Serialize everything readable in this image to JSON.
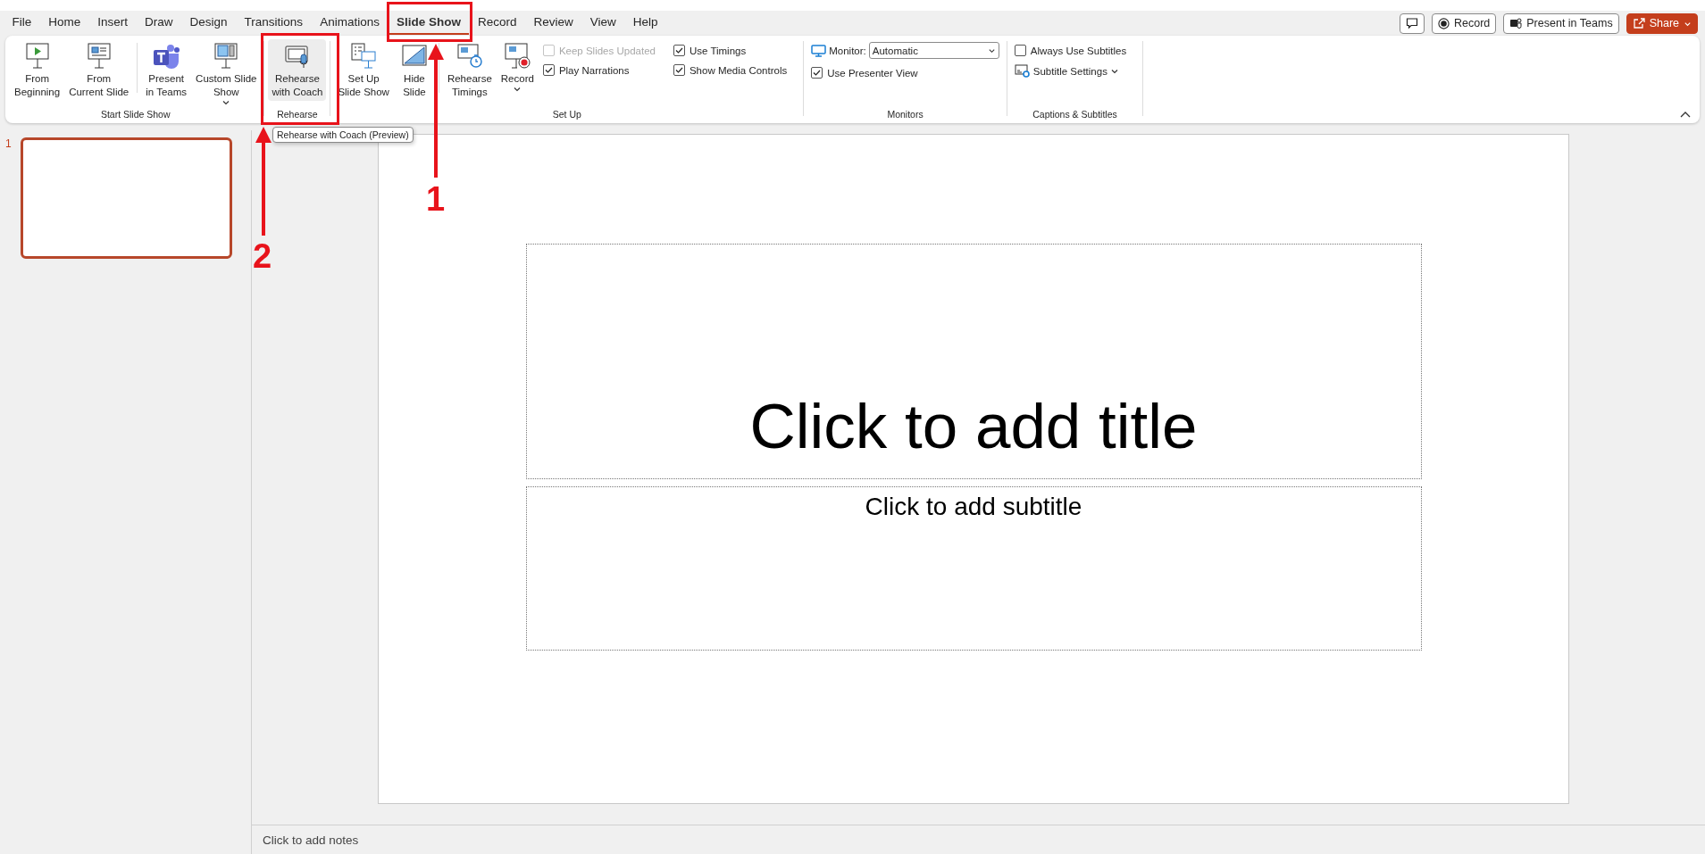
{
  "tabs": [
    {
      "label": "File",
      "selected": false
    },
    {
      "label": "Home",
      "selected": false
    },
    {
      "label": "Insert",
      "selected": false
    },
    {
      "label": "Draw",
      "selected": false
    },
    {
      "label": "Design",
      "selected": false
    },
    {
      "label": "Transitions",
      "selected": false
    },
    {
      "label": "Animations",
      "selected": false
    },
    {
      "label": "Slide Show",
      "selected": true
    },
    {
      "label": "Record",
      "selected": false
    },
    {
      "label": "Review",
      "selected": false
    },
    {
      "label": "View",
      "selected": false
    },
    {
      "label": "Help",
      "selected": false
    }
  ],
  "title_bar_buttons": [
    {
      "kind": "comments"
    },
    {
      "kind": "record",
      "label": "Record"
    },
    {
      "kind": "teams",
      "label": "Present in Teams"
    },
    {
      "kind": "share",
      "label": "Share"
    }
  ],
  "ribbon": {
    "groups": [
      {
        "label": "Start Slide Show",
        "items": [
          {
            "kind": "large",
            "lines": [
              "From",
              "Beginning"
            ],
            "has_menu": false,
            "highlighted": false
          },
          {
            "kind": "large",
            "lines": [
              "From",
              "Current Slide"
            ],
            "has_menu": false,
            "highlighted": false
          },
          {
            "kind": "separator"
          },
          {
            "kind": "large",
            "lines": [
              "Present",
              "in Teams"
            ],
            "has_menu": false,
            "highlighted": false
          },
          {
            "kind": "large",
            "lines": [
              "Custom Slide",
              "Show"
            ],
            "has_menu": true,
            "highlighted": false
          }
        ]
      },
      {
        "label": "Rehearse",
        "items": [
          {
            "kind": "large",
            "lines": [
              "Rehearse",
              "with Coach"
            ],
            "has_menu": false,
            "highlighted": true
          }
        ]
      },
      {
        "label": "Set Up",
        "items": [
          {
            "kind": "large",
            "lines": [
              "Set Up",
              "Slide Show"
            ],
            "has_menu": false,
            "highlighted": false
          },
          {
            "kind": "large",
            "lines": [
              "Hide",
              "Slide"
            ],
            "has_menu": false,
            "highlighted": false
          },
          {
            "kind": "separator"
          },
          {
            "kind": "large",
            "lines": [
              "Rehearse",
              "Timings"
            ],
            "has_menu": false,
            "highlighted": false
          },
          {
            "kind": "large",
            "lines": [
              "Record"
            ],
            "has_menu": true,
            "highlighted": false
          },
          {
            "kind": "column",
            "items": [
              {
                "kind": "checkbox",
                "label": "Keep Slides Updated",
                "checked": false,
                "disabled": true
              },
              {
                "kind": "checkbox",
                "label": "Play Narrations",
                "checked": true,
                "disabled": false
              }
            ]
          },
          {
            "kind": "column",
            "items": [
              {
                "kind": "checkbox",
                "label": "Use Timings",
                "checked": true,
                "disabled": false
              },
              {
                "kind": "checkbox",
                "label": "Show Media Controls",
                "checked": true,
                "disabled": false
              }
            ]
          }
        ]
      },
      {
        "label": "Monitors",
        "items": [
          {
            "kind": "column",
            "items": [
              {
                "kind": "dropdown",
                "label": "Monitor:",
                "value": "Automatic"
              },
              {
                "kind": "checkbox",
                "label": "Use Presenter View",
                "checked": true,
                "disabled": false
              }
            ]
          }
        ]
      },
      {
        "label": "Captions & Subtitles",
        "items": [
          {
            "kind": "column",
            "items": [
              {
                "kind": "checkbox",
                "label": "Always Use Subtitles",
                "checked": false,
                "disabled": false
              },
              {
                "kind": "menu",
                "label": "Subtitle Settings"
              }
            ]
          }
        ]
      }
    ]
  },
  "tooltip": "Rehearse with Coach (Preview)",
  "slides": [
    {
      "number": "1",
      "selected": true
    }
  ],
  "slide": {
    "title_placeholder": "Click to add title",
    "subtitle_placeholder": "Click to add subtitle"
  },
  "notes_placeholder": "Click to add notes",
  "annotations": [
    {
      "number": "1"
    },
    {
      "number": "2"
    }
  ]
}
